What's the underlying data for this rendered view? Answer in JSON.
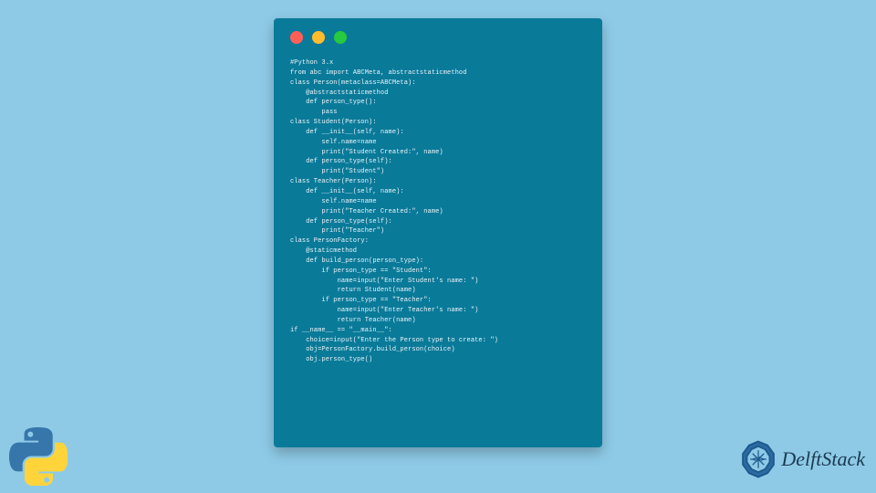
{
  "code": {
    "lines": "#Python 3.x\nfrom abc import ABCMeta, abstractstaticmethod\nclass Person(metaclass=ABCMeta):\n    @abstractstaticmethod\n    def person_type():\n        pass\nclass Student(Person):\n    def __init__(self, name):\n        self.name=name\n        print(\"Student Created:\", name)\n    def person_type(self):\n        print(\"Student\")\nclass Teacher(Person):\n    def __init__(self, name):\n        self.name=name\n        print(\"Teacher Created:\", name)\n    def person_type(self):\n        print(\"Teacher\")\nclass PersonFactory:\n    @staticmethod\n    def build_person(person_type):\n        if person_type == \"Student\":\n            name=input(\"Enter Student's name: \")\n            return Student(name)\n        if person_type == \"Teacher\":\n            name=input(\"Enter Teacher's name: \")\n            return Teacher(name)\nif __name__ == \"__main__\":\n    choice=input(\"Enter the Person type to create: \")\n    obj=PersonFactory.build_person(choice)\n    obj.person_type()"
  },
  "brand": {
    "name": "DelftStack"
  }
}
